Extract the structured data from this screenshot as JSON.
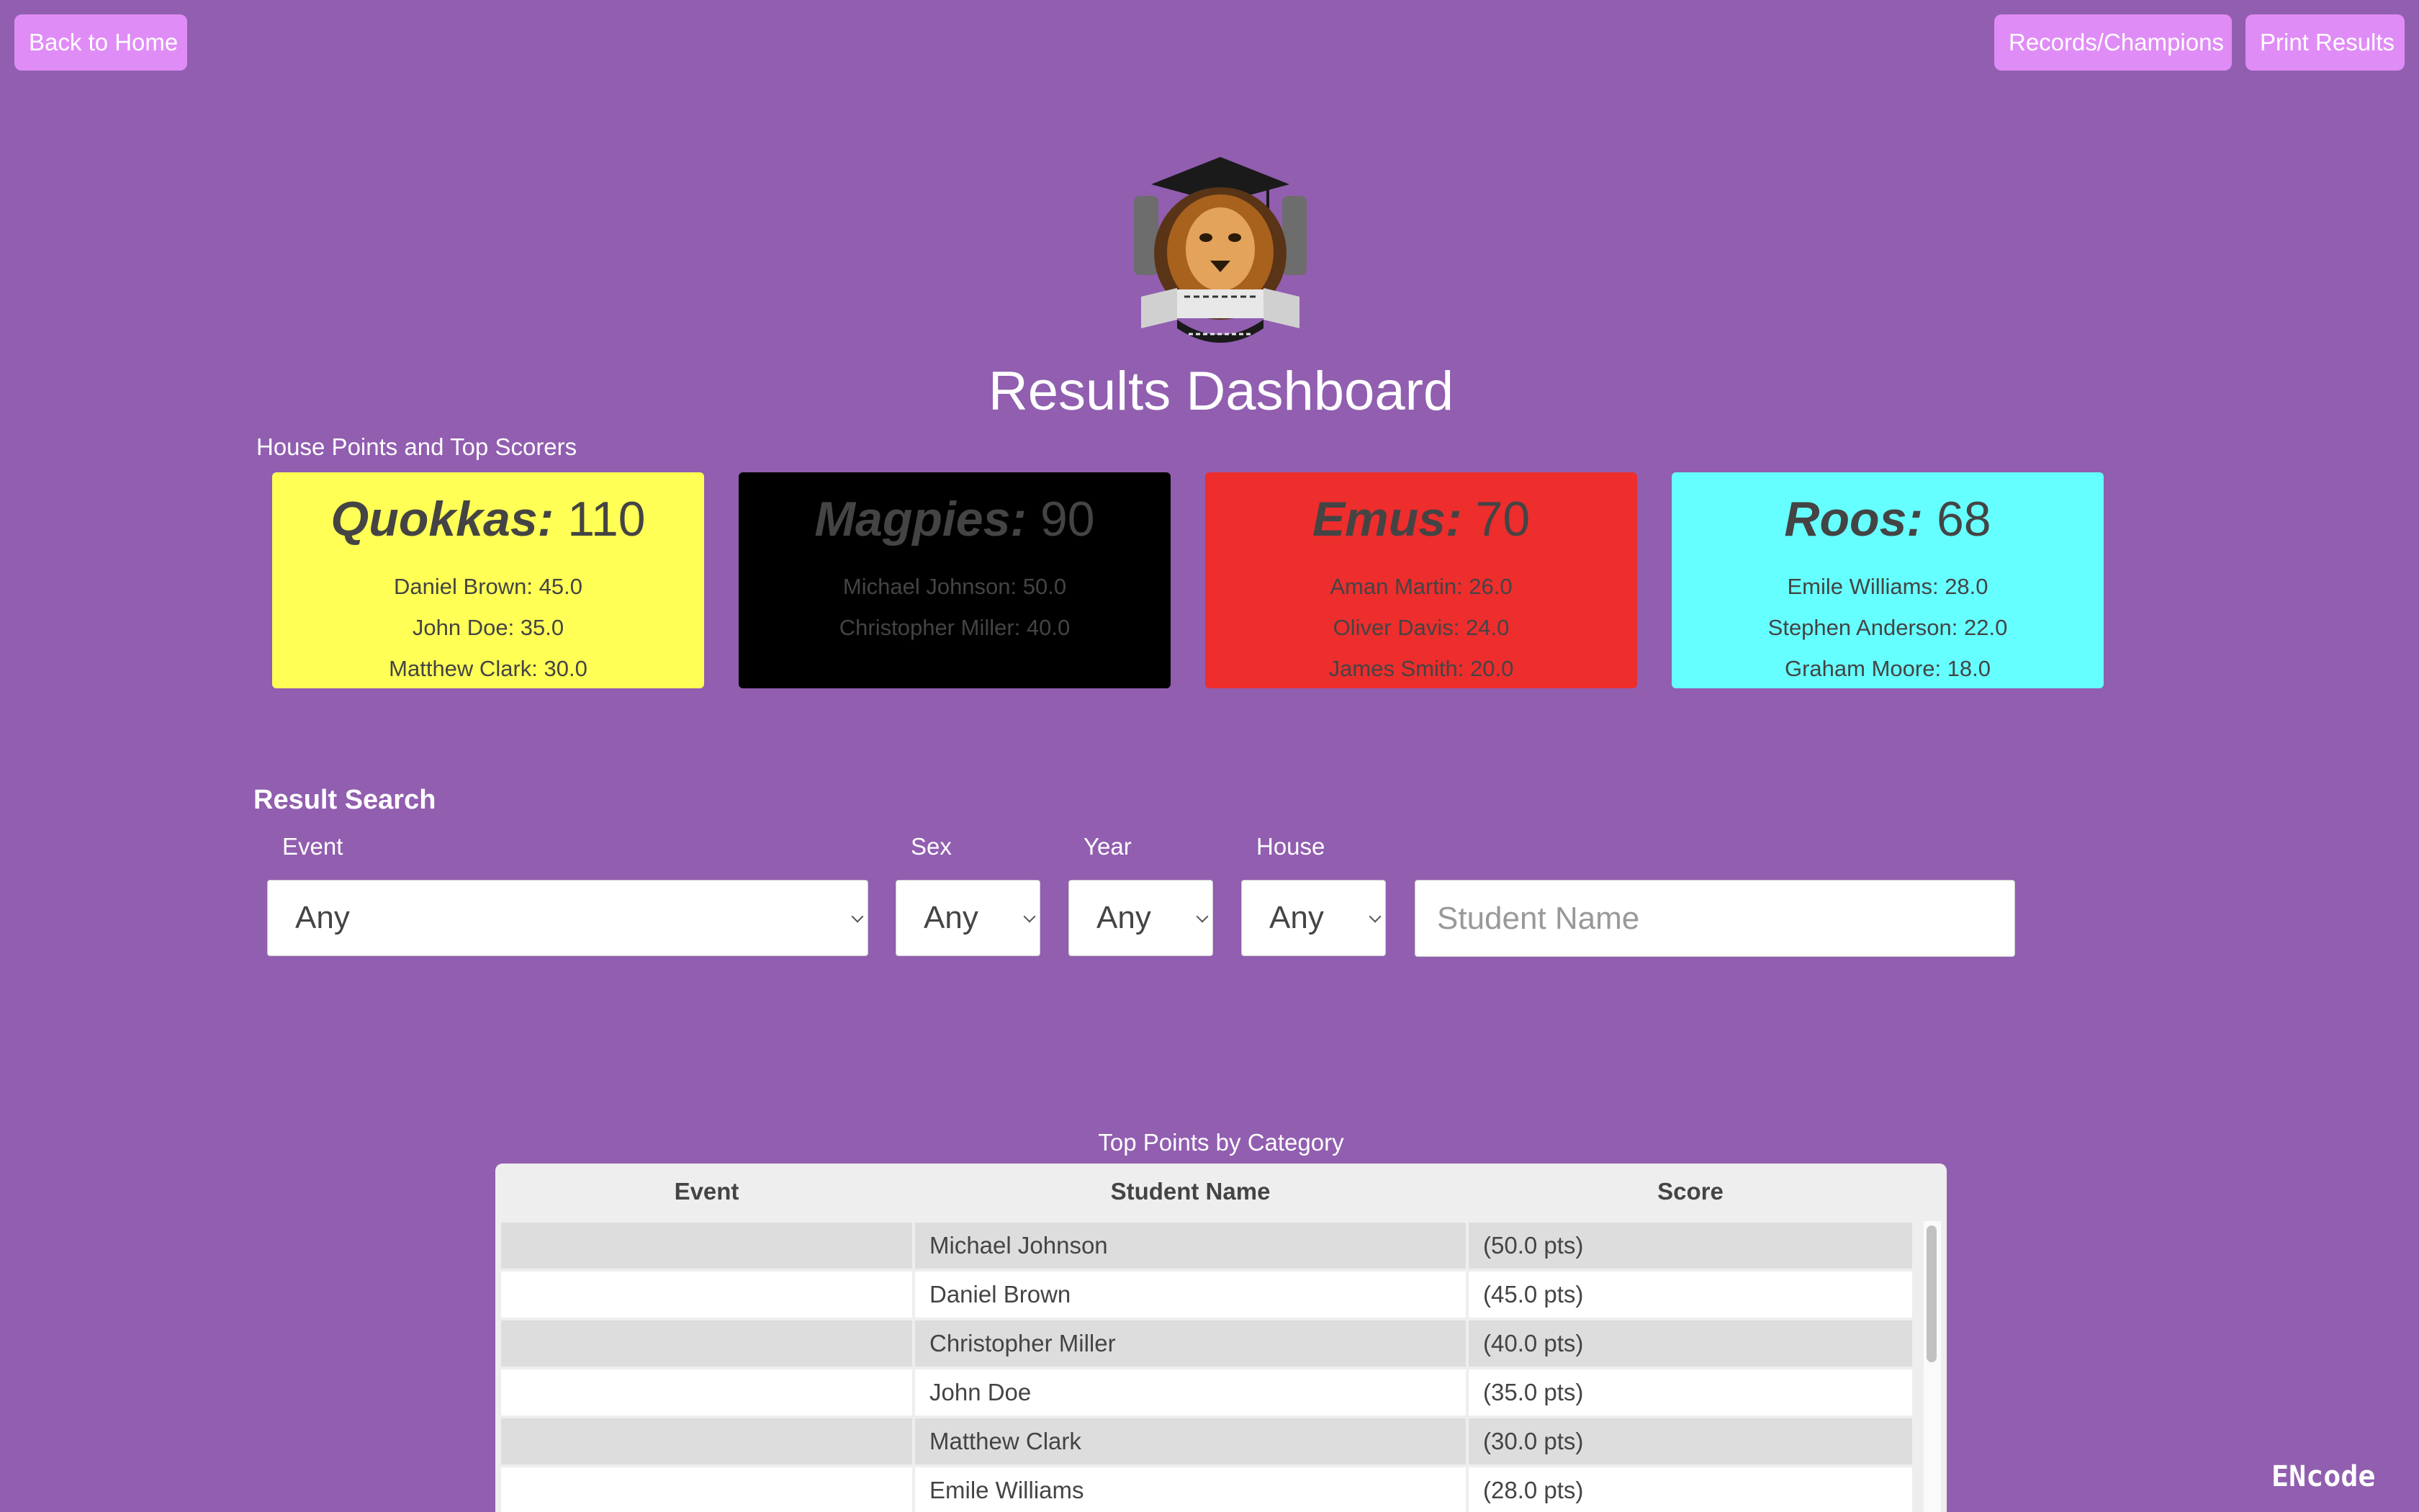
{
  "nav": {
    "back_label": "Back to Home",
    "records_label": "Records/Champions",
    "print_label": "Print Results"
  },
  "page_title": "Results Dashboard",
  "house_section_label": "House Points and Top Scorers",
  "houses": [
    {
      "name": "Quokkas:",
      "points": "110",
      "color": "#ffff55",
      "text_color": "#444444",
      "scorers": [
        "Daniel Brown: 45.0",
        "John Doe: 35.0",
        "Matthew Clark: 30.0"
      ]
    },
    {
      "name": "Magpies:",
      "points": "90",
      "color": "#000000",
      "text_color": "#444444",
      "scorers": [
        "Michael Johnson: 50.0",
        "Christopher Miller: 40.0"
      ]
    },
    {
      "name": "Emus:",
      "points": "70",
      "color": "#ee2d2d",
      "text_color": "#444444",
      "scorers": [
        "Aman Martin: 26.0",
        "Oliver Davis: 24.0",
        "James Smith: 20.0"
      ]
    },
    {
      "name": "Roos:",
      "points": "68",
      "color": "#66ffff",
      "text_color": "#444444",
      "scorers": [
        "Emile Williams: 28.0",
        "Stephen Anderson: 22.0",
        "Graham Moore: 18.0"
      ]
    }
  ],
  "search": {
    "title": "Result Search",
    "event_label": "Event",
    "event_value": "Any",
    "sex_label": "Sex",
    "sex_value": "Any",
    "year_label": "Year",
    "year_value": "Any",
    "house_label": "House",
    "house_value": "Any",
    "name_placeholder": "Student Name"
  },
  "table": {
    "title": "Top Points by Category",
    "headers": [
      "Event",
      "Student Name",
      "Score"
    ],
    "rows": [
      {
        "event": "",
        "name": "Michael Johnson",
        "score": "(50.0 pts)"
      },
      {
        "event": "",
        "name": "Daniel Brown",
        "score": "(45.0 pts)"
      },
      {
        "event": "",
        "name": "Christopher Miller",
        "score": "(40.0 pts)"
      },
      {
        "event": "",
        "name": "John Doe",
        "score": "(35.0 pts)"
      },
      {
        "event": "",
        "name": "Matthew Clark",
        "score": "(30.0 pts)"
      },
      {
        "event": "",
        "name": "Emile Williams",
        "score": "(28.0 pts)"
      }
    ]
  },
  "brand": "ENcode"
}
